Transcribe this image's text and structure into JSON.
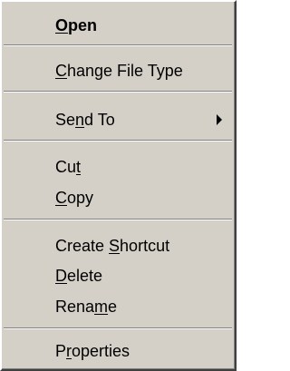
{
  "menu": {
    "items": [
      {
        "before": "",
        "accel": "O",
        "after": "pen"
      },
      {
        "before": "",
        "accel": "C",
        "after": "hange File Type"
      },
      {
        "before": "Se",
        "accel": "n",
        "after": "d To"
      },
      {
        "before": "Cu",
        "accel": "t",
        "after": ""
      },
      {
        "before": "",
        "accel": "C",
        "after": "opy"
      },
      {
        "before": "Create ",
        "accel": "S",
        "after": "hortcut"
      },
      {
        "before": "",
        "accel": "D",
        "after": "elete"
      },
      {
        "before": "Rena",
        "accel": "m",
        "after": "e"
      },
      {
        "before": "P",
        "accel": "r",
        "after": "operties"
      }
    ],
    "submenu_arrow_icon": "right-triangle-icon",
    "colors": {
      "background": "#d4d0c8",
      "text": "#000000",
      "separator_dark": "#808080",
      "separator_light": "#ffffff"
    }
  }
}
